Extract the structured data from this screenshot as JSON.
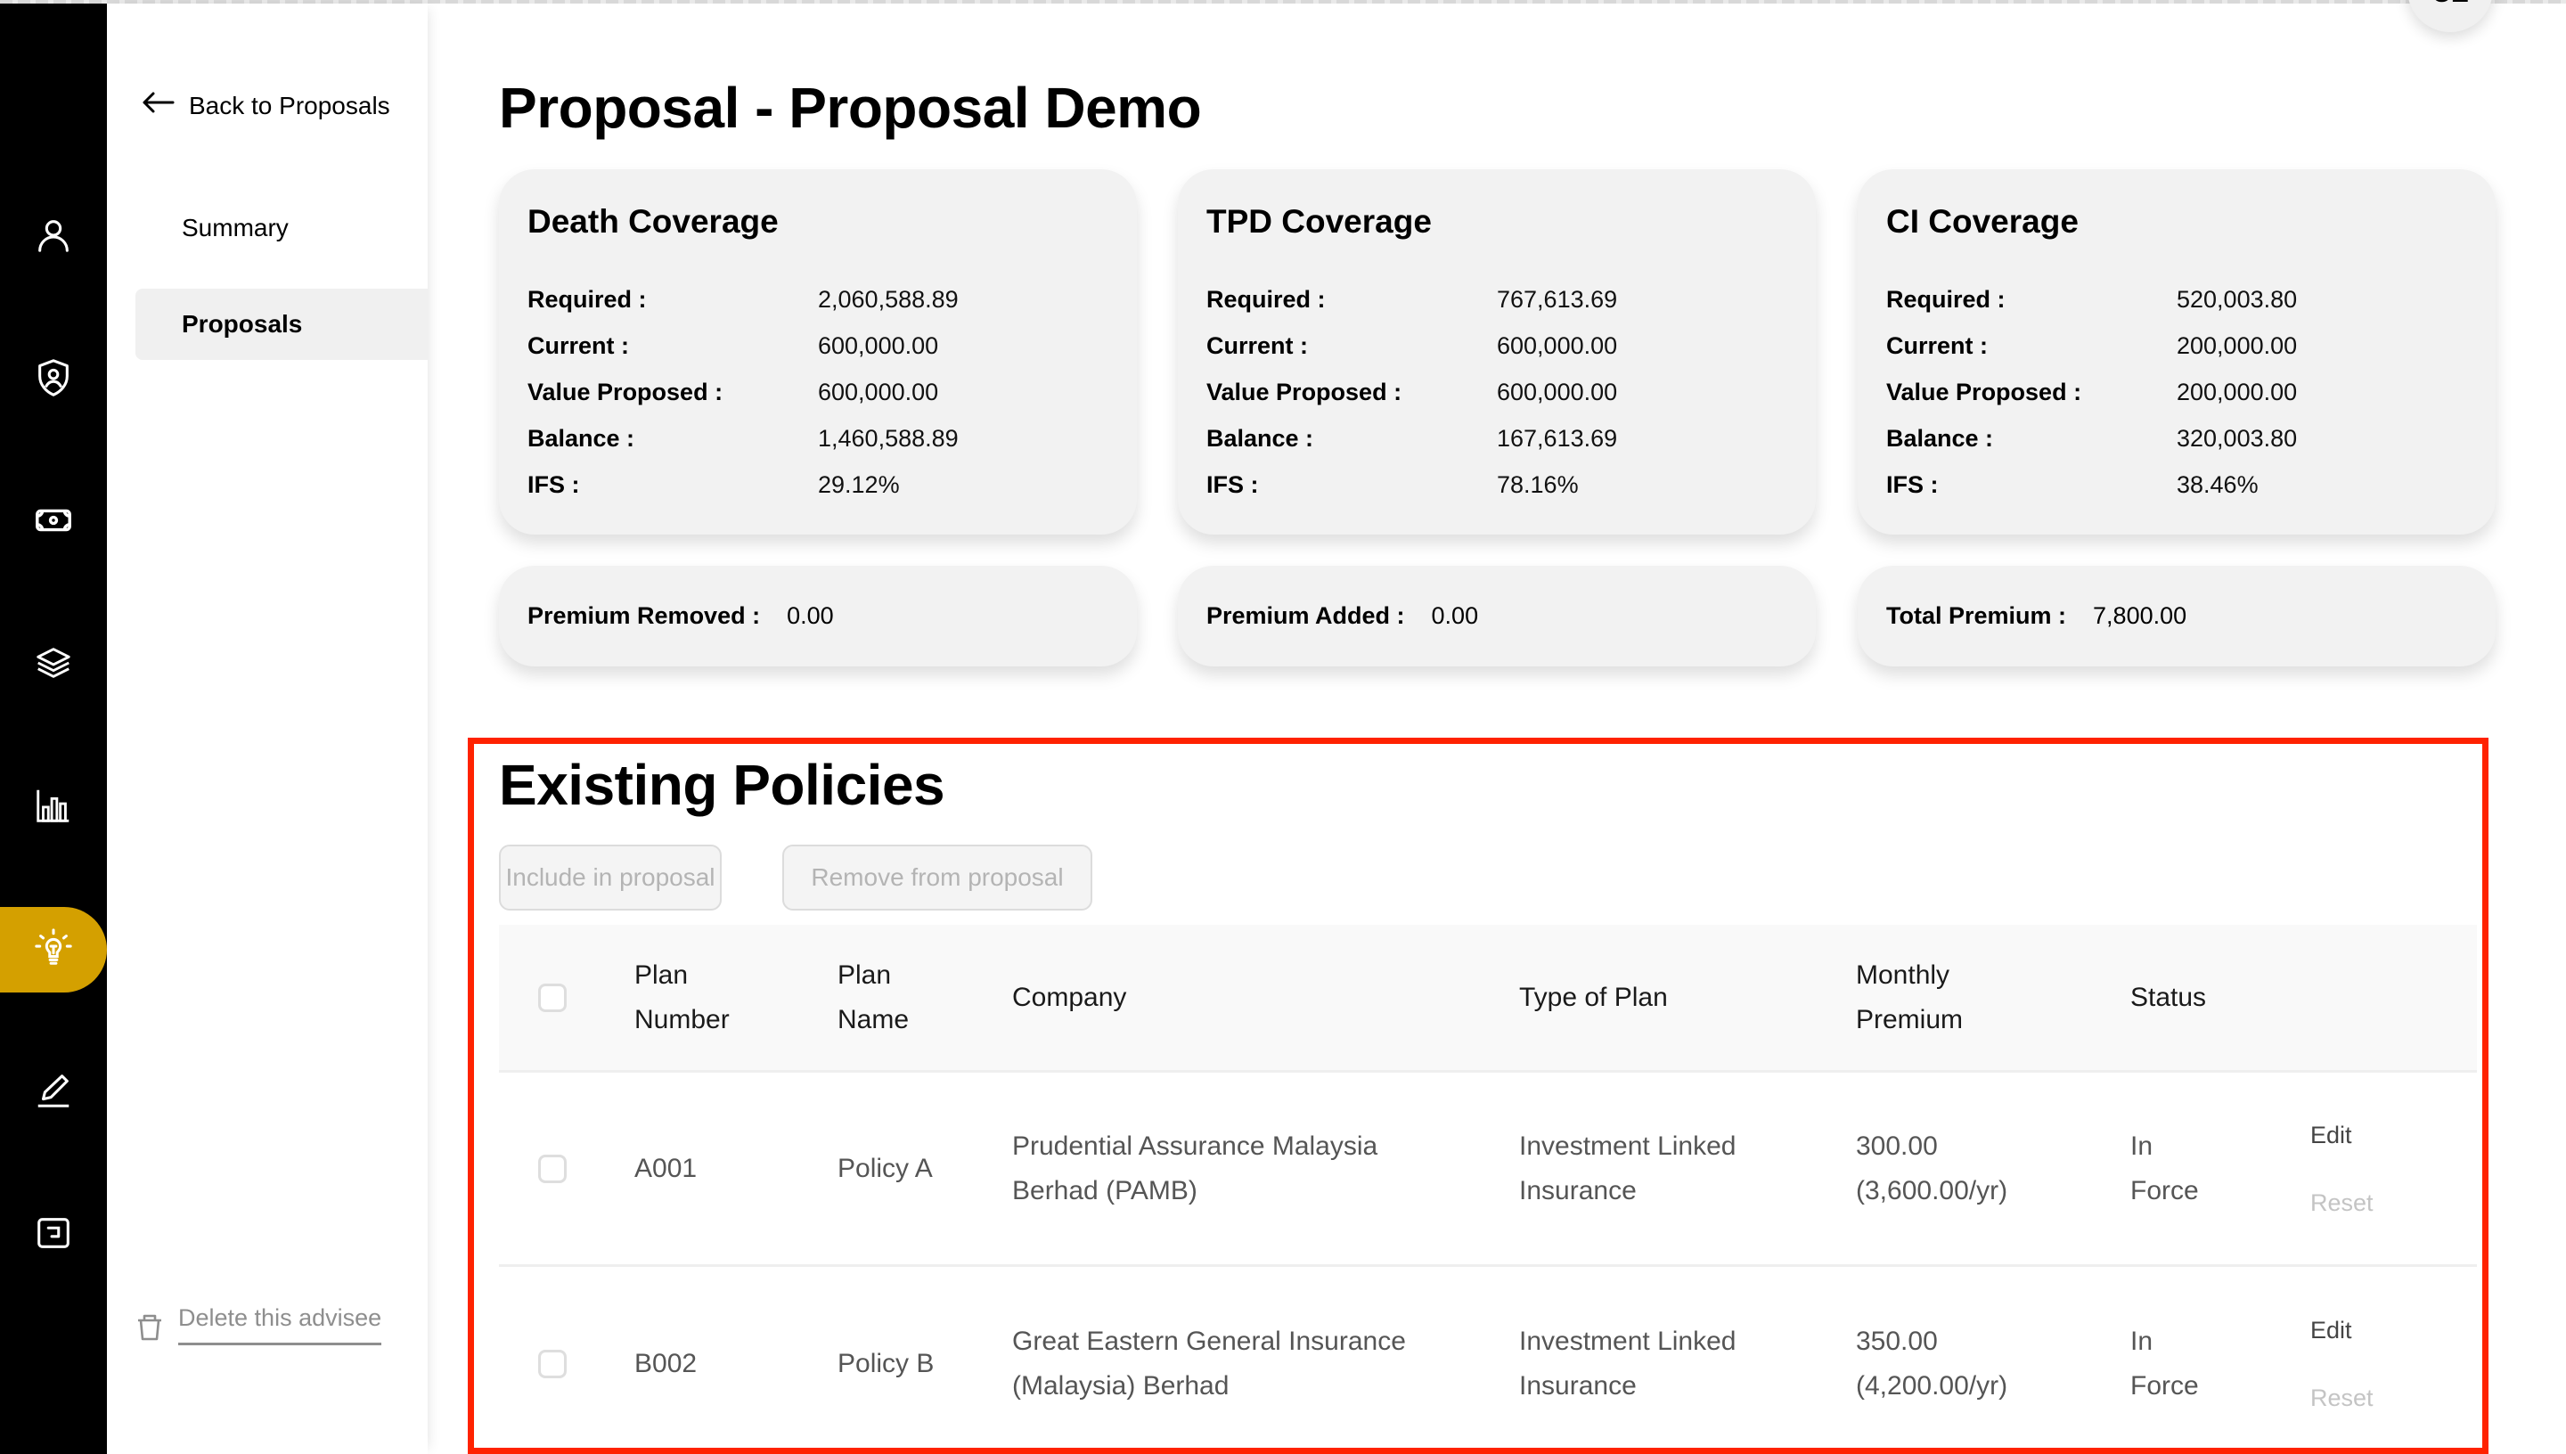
{
  "rail": {
    "items": [
      {
        "icon": "user-icon",
        "active": false
      },
      {
        "icon": "shield-user-icon",
        "active": false
      },
      {
        "icon": "money-icon",
        "active": false
      },
      {
        "icon": "layers-icon",
        "active": false
      },
      {
        "icon": "bar-chart-icon",
        "active": false
      },
      {
        "icon": "lightbulb-icon",
        "active": true
      },
      {
        "icon": "pen-icon",
        "active": false
      },
      {
        "icon": "export-icon",
        "active": false
      }
    ],
    "active_color": "#d4a000"
  },
  "subnav": {
    "back_label": "Back to Proposals",
    "items": [
      {
        "label": "Summary",
        "active": false
      },
      {
        "label": "Proposals",
        "active": true
      }
    ],
    "delete_label": "Delete this advisee"
  },
  "header": {
    "title": "Proposal - Proposal Demo",
    "avatar_initials": "CE"
  },
  "coverage_cards": [
    {
      "title": "Death Coverage",
      "rows": [
        {
          "label": "Required :",
          "value": "2,060,588.89"
        },
        {
          "label": "Current :",
          "value": "600,000.00"
        },
        {
          "label": "Value Proposed :",
          "value": "600,000.00"
        },
        {
          "label": "Balance :",
          "value": "1,460,588.89"
        },
        {
          "label": "IFS :",
          "value": "29.12%"
        }
      ]
    },
    {
      "title": "TPD Coverage",
      "rows": [
        {
          "label": "Required :",
          "value": "767,613.69"
        },
        {
          "label": "Current :",
          "value": "600,000.00"
        },
        {
          "label": "Value Proposed :",
          "value": "600,000.00"
        },
        {
          "label": "Balance :",
          "value": "167,613.69"
        },
        {
          "label": "IFS :",
          "value": "78.16%"
        }
      ]
    },
    {
      "title": "CI Coverage",
      "rows": [
        {
          "label": "Required :",
          "value": "520,003.80"
        },
        {
          "label": "Current :",
          "value": "200,000.00"
        },
        {
          "label": "Value Proposed :",
          "value": "200,000.00"
        },
        {
          "label": "Balance :",
          "value": "320,003.80"
        },
        {
          "label": "IFS :",
          "value": "38.46%"
        }
      ]
    }
  ],
  "premium_cards": [
    {
      "label": "Premium Removed :",
      "value": "0.00"
    },
    {
      "label": "Premium Added :",
      "value": "0.00"
    },
    {
      "label": "Total Premium :",
      "value": "7,800.00"
    }
  ],
  "existing_policies": {
    "title": "Existing Policies",
    "include_button": "Include in proposal",
    "remove_button": "Remove from proposal",
    "highlight_color": "#ff2200",
    "columns": {
      "plan_number": [
        "Plan",
        "Number"
      ],
      "plan_name": [
        "Plan",
        "Name"
      ],
      "company": "Company",
      "type": "Type of Plan",
      "premium": [
        "Monthly",
        "Premium"
      ],
      "status": "Status"
    },
    "rows": [
      {
        "plan_number": "A001",
        "plan_name": "Policy A",
        "company": [
          "Prudential Assurance Malaysia",
          "Berhad (PAMB)"
        ],
        "type": [
          "Investment Linked",
          "Insurance"
        ],
        "premium": [
          "300.00",
          "(3,600.00/yr)"
        ],
        "status": [
          "In",
          "Force"
        ],
        "edit_label": "Edit",
        "reset_label": "Reset"
      },
      {
        "plan_number": "B002",
        "plan_name": "Policy B",
        "company": [
          "Great Eastern General Insurance",
          "(Malaysia) Berhad"
        ],
        "type": [
          "Investment Linked",
          "Insurance"
        ],
        "premium": [
          "350.00",
          "(4,200.00/yr)"
        ],
        "status": [
          "In",
          "Force"
        ],
        "edit_label": "Edit",
        "reset_label": "Reset"
      }
    ]
  }
}
